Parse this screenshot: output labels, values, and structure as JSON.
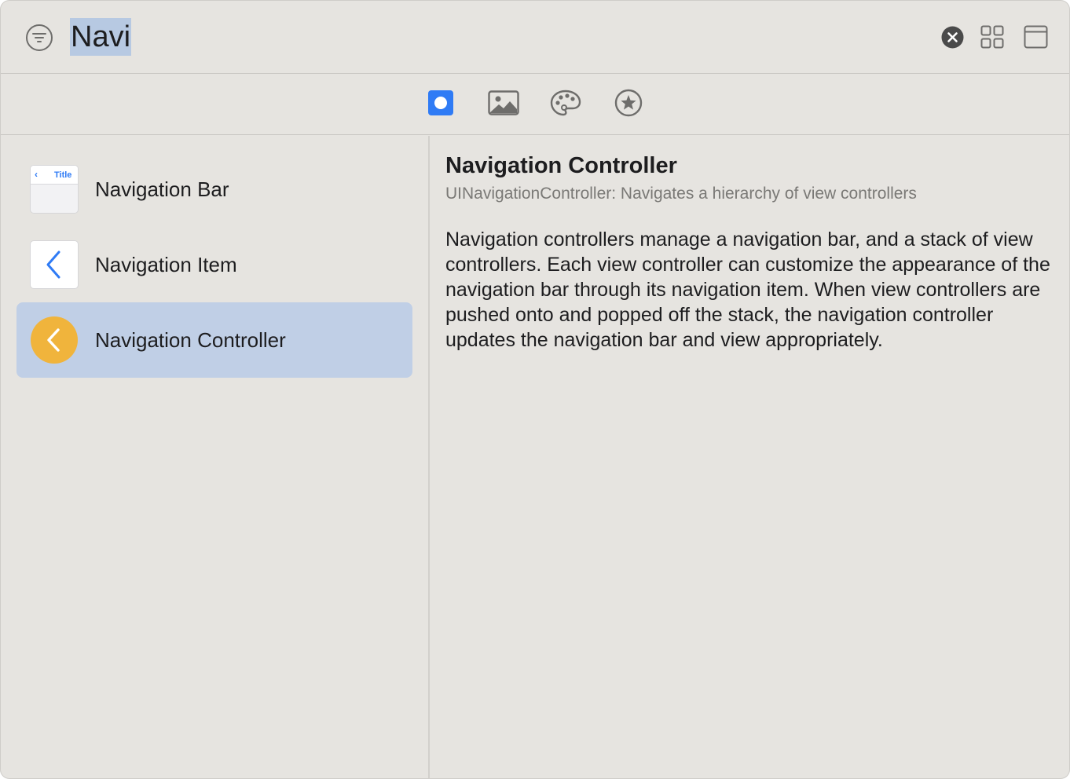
{
  "search": {
    "query": "Navi"
  },
  "icons": {
    "filter": "filter-icon",
    "clear": "clear-search-icon",
    "grid": "grid-view-icon",
    "panel": "detail-panel-icon"
  },
  "tabs": [
    {
      "name": "objects",
      "icon": "objects-icon",
      "selected": true
    },
    {
      "name": "media",
      "icon": "image-icon",
      "selected": false
    },
    {
      "name": "colors",
      "icon": "palette-icon",
      "selected": false
    },
    {
      "name": "symbols",
      "icon": "star-icon",
      "selected": false
    }
  ],
  "list": {
    "items": [
      {
        "label": "Navigation Bar",
        "thumb_title": "Title",
        "selected": false
      },
      {
        "label": "Navigation Item",
        "selected": false
      },
      {
        "label": "Navigation Controller",
        "selected": true
      }
    ]
  },
  "detail": {
    "title": "Navigation Controller",
    "subtitle": "UINavigationController: Navigates a hierarchy of view controllers",
    "description": "Navigation controllers manage a navigation bar, and a stack of view controllers. Each view controller can customize the appearance of the navigation bar through its navigation item. When view controllers are pushed onto and popped off the stack, the navigation controller updates the navigation bar and view appropriately."
  },
  "colors": {
    "accent": "#2f7bf5",
    "selection": "#c0cfe6",
    "controller_icon": "#f0b43c"
  }
}
